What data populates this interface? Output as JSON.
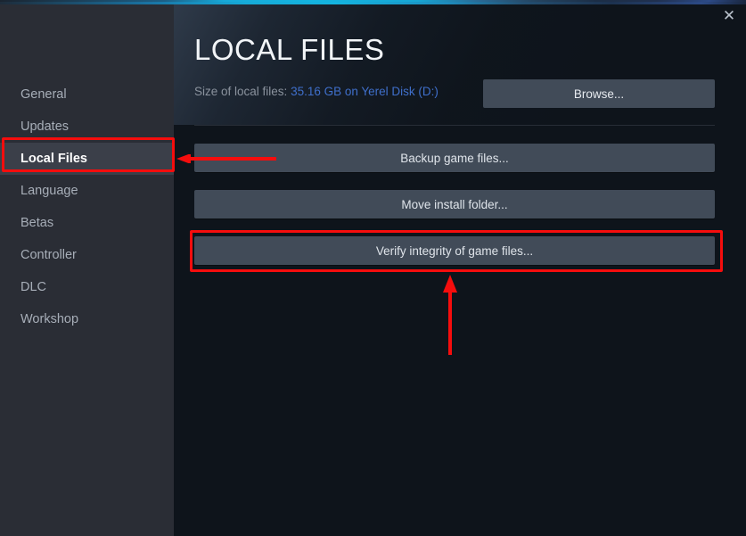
{
  "window": {
    "close_label": "✕"
  },
  "sidebar": {
    "logo_text": "",
    "items": [
      {
        "label": "General",
        "active": false
      },
      {
        "label": "Updates",
        "active": false
      },
      {
        "label": "Local Files",
        "active": true
      },
      {
        "label": "Language",
        "active": false
      },
      {
        "label": "Betas",
        "active": false
      },
      {
        "label": "Controller",
        "active": false
      },
      {
        "label": "DLC",
        "active": false
      },
      {
        "label": "Workshop",
        "active": false
      }
    ]
  },
  "main": {
    "title": "LOCAL FILES",
    "size_label": "Size of local files:",
    "size_value": "35.16 GB on Yerel Disk (D:)",
    "browse_label": "Browse...",
    "buttons": [
      {
        "label": "Backup game files..."
      },
      {
        "label": "Move install folder..."
      },
      {
        "label": "Verify integrity of game files..."
      }
    ]
  },
  "annotations": {
    "highlight_color": "#f50d0d",
    "boxes": [
      {
        "target": "Local Files"
      },
      {
        "target": "Verify integrity of game files..."
      }
    ],
    "arrows": [
      {
        "direction": "left",
        "target": "Local Files"
      },
      {
        "direction": "up",
        "target": "Verify integrity of game files..."
      }
    ]
  },
  "colors": {
    "sidebar_bg": "#2a2d35",
    "content_bg": "#0e141b",
    "button_bg": "#414b58",
    "link_blue": "#3f6fcb",
    "active_item_bg": "#3b3f49"
  }
}
